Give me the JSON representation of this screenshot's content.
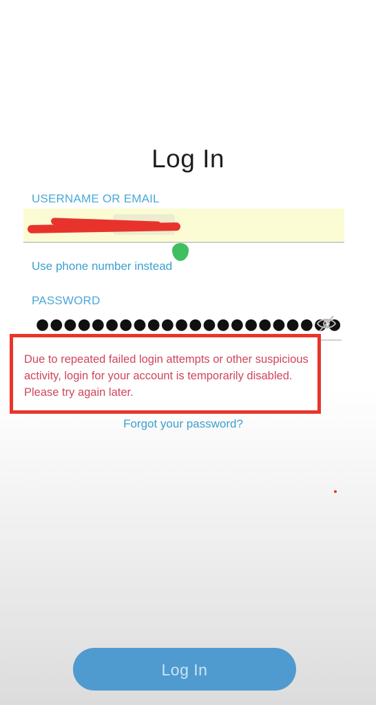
{
  "screen": {
    "title": "Log In"
  },
  "username": {
    "label": "USERNAME OR EMAIL",
    "alt_link": "Use phone number instead"
  },
  "password": {
    "label": "PASSWORD",
    "masked_value": "●●●●●●●●●●●●●●●●●●●●●●"
  },
  "error": {
    "message": "Due to repeated failed login attempts or other suspicious activity, login for your account is temporarily disabled. Please try again later."
  },
  "forgot_link": "Forgot your password?",
  "login_button": "Log In",
  "colors": {
    "accent": "#4aa8d8",
    "button": "#4f9bd0",
    "error_border": "#e8352b",
    "error_text": "#d0455a",
    "autofill": "#fbfbd4"
  },
  "icons": {
    "password_visibility": "eye-slash-icon"
  }
}
